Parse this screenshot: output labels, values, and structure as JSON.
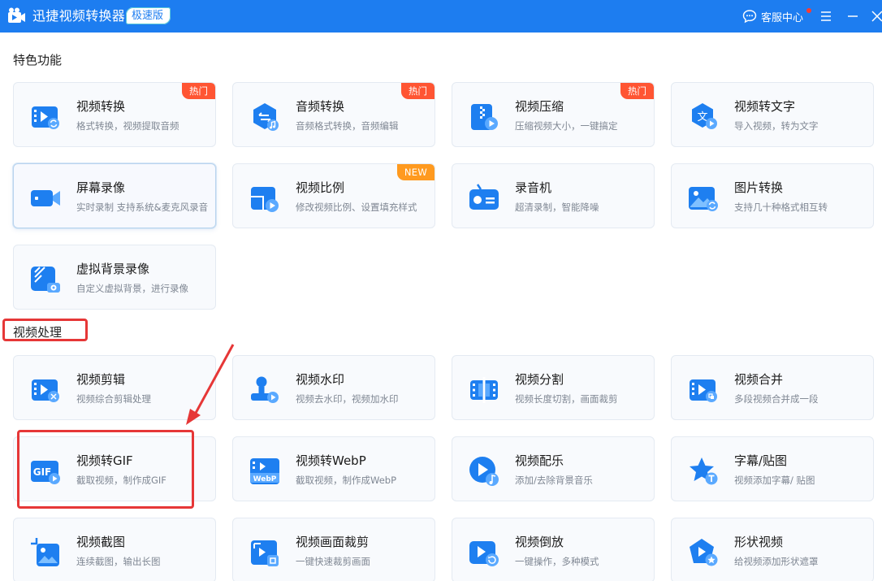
{
  "app": {
    "title": "迅捷视频转换器",
    "edition_badge": "极速版",
    "support_label": "客服中心",
    "brand_color": "#1d7df0"
  },
  "sections": [
    {
      "title": "特色功能",
      "cards": [
        {
          "title": "视频转换",
          "desc": "格式转换，视频提取音频",
          "badge": "热门",
          "icon": "video-convert-icon"
        },
        {
          "title": "音频转换",
          "desc": "音频格式转换，音频编辑",
          "badge": "热门",
          "icon": "audio-convert-icon"
        },
        {
          "title": "视频压缩",
          "desc": "压缩视频大小，一键搞定",
          "badge": "热门",
          "icon": "video-compress-icon"
        },
        {
          "title": "视频转文字",
          "desc": "导入视频，转为文字",
          "icon": "video-to-text-icon"
        },
        {
          "title": "屏幕录像",
          "desc": "实时录制 支持系统&麦克风录音",
          "icon": "screen-record-icon",
          "selected": true
        },
        {
          "title": "视频比例",
          "desc": "修改视频比例、设置填充样式",
          "badge": "NEW",
          "icon": "video-ratio-icon"
        },
        {
          "title": "录音机",
          "desc": "超清录制，智能降噪",
          "icon": "recorder-icon"
        },
        {
          "title": "图片转换",
          "desc": "支持几十种格式相互转",
          "icon": "image-convert-icon"
        },
        {
          "title": "虚拟背景录像",
          "desc": "自定义虚拟背景，进行录像",
          "icon": "virtual-bg-icon"
        }
      ]
    },
    {
      "title": "视频处理",
      "cards": [
        {
          "title": "视频剪辑",
          "desc": "视频综合剪辑处理",
          "icon": "video-edit-icon"
        },
        {
          "title": "视频水印",
          "desc": "视频去水印，视频加水印",
          "icon": "watermark-icon"
        },
        {
          "title": "视频分割",
          "desc": "视频长度切割，画面裁剪",
          "icon": "video-split-icon"
        },
        {
          "title": "视频合并",
          "desc": "多段视频合并成一段",
          "icon": "video-merge-icon"
        },
        {
          "title": "视频转GIF",
          "desc": "截取视频，制作成GIF",
          "icon": "gif-icon",
          "icon_text": "GIF"
        },
        {
          "title": "视频转WebP",
          "desc": "截取视频，制作成WebP",
          "icon": "webp-icon",
          "icon_text": "WebP"
        },
        {
          "title": "视频配乐",
          "desc": "添加/去除背景音乐",
          "icon": "music-icon"
        },
        {
          "title": "字幕/贴图",
          "desc": "视频添加字幕/ 贴图",
          "icon": "subtitle-icon"
        },
        {
          "title": "视频截图",
          "desc": "连续截图，输出长图",
          "icon": "screenshot-icon"
        },
        {
          "title": "视频画面裁剪",
          "desc": "一键快速裁剪画面",
          "icon": "crop-icon"
        },
        {
          "title": "视频倒放",
          "desc": "一键操作，多种模式",
          "icon": "reverse-icon"
        },
        {
          "title": "形状视频",
          "desc": "给视频添加形状遮罩",
          "icon": "shape-video-icon"
        }
      ]
    }
  ],
  "annotation_color": "#e63737"
}
